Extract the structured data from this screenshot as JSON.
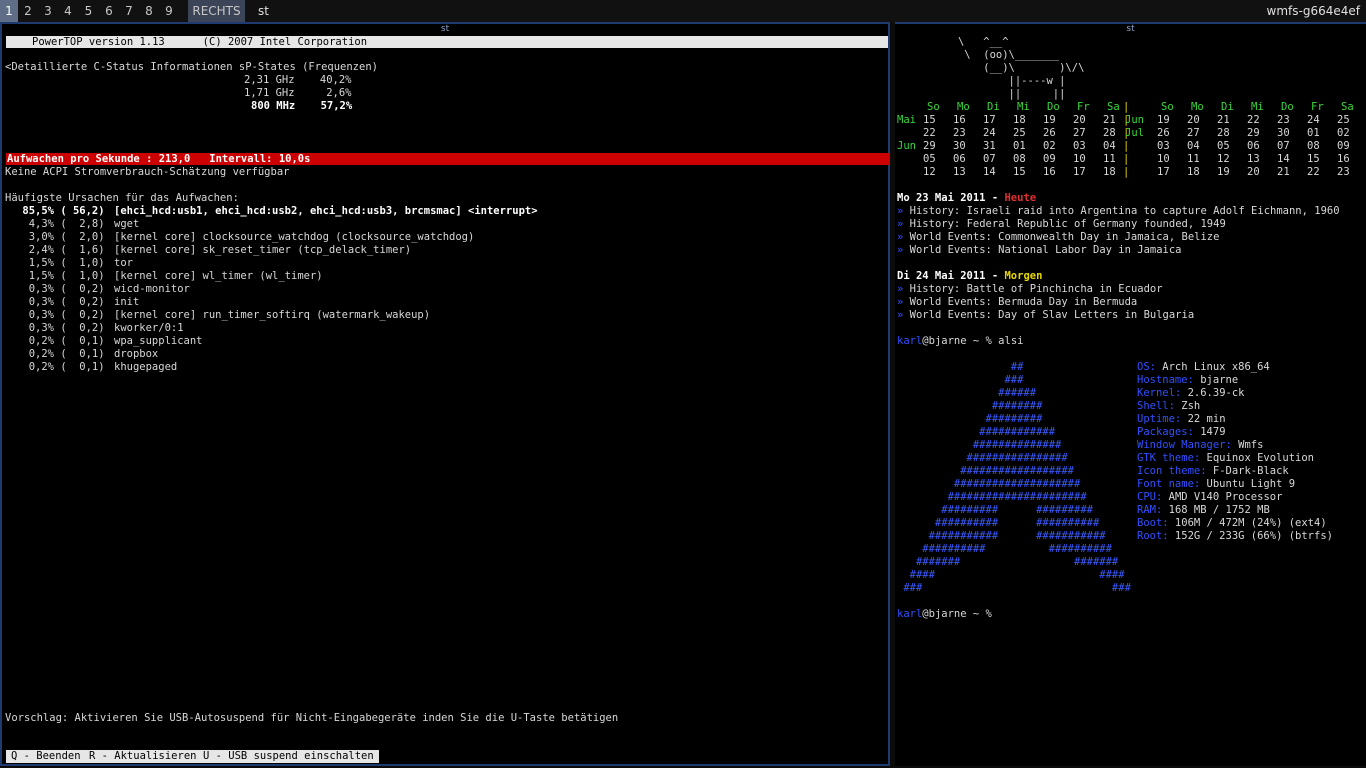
{
  "topbar": {
    "tags": [
      {
        "label": "1",
        "active": true
      },
      {
        "label": "2"
      },
      {
        "label": "3"
      },
      {
        "label": "4"
      },
      {
        "label": "5"
      },
      {
        "label": "6"
      },
      {
        "label": "7"
      },
      {
        "label": "8"
      },
      {
        "label": "9"
      }
    ],
    "layout": "RECHTS",
    "client_title": "st",
    "hostname": "wmfs-g664e4ef"
  },
  "left_window": {
    "title": "st",
    "powertop": {
      "header": "PowerTOP version 1.13      (C) 2007 Intel Corporation",
      "cstate_line": "<Detaillierte C-Status Informationen sP-States (Frequenzen)",
      "pstates": [
        {
          "freq": "2,31 GHz",
          "pct": "40,2%",
          "bold": false
        },
        {
          "freq": "1,71 GHz",
          "pct": "2,6%",
          "bold": false
        },
        {
          "freq": "800 MHz",
          "pct": "57,2%",
          "bold": true
        }
      ],
      "wakeups_bar": "Aufwachen pro Sekunde : 213,0   Intervall: 10,0s",
      "acpi_line": "Keine ACPI Stromverbrauch-Schätzung verfügbar",
      "causes_heading": "Häufigste Ursachen für das Aufwachen:",
      "causes": [
        {
          "pct": "85,5%",
          "count": "56,2",
          "name": "[ehci_hcd:usb1, ehci_hcd:usb2, ehci_hcd:usb3, brcmsmac] <interrupt>",
          "bold": true
        },
        {
          "pct": "4,3%",
          "count": "2,8",
          "name": "wget"
        },
        {
          "pct": "3,0%",
          "count": "2,0",
          "name": "[kernel core] clocksource_watchdog (clocksource_watchdog)"
        },
        {
          "pct": "2,4%",
          "count": "1,6",
          "name": "[kernel core] sk_reset_timer (tcp_delack_timer)"
        },
        {
          "pct": "1,5%",
          "count": "1,0",
          "name": "tor"
        },
        {
          "pct": "1,5%",
          "count": "1,0",
          "name": "[kernel core] wl_timer (wl_timer)"
        },
        {
          "pct": "0,3%",
          "count": "0,2",
          "name": "wicd-monitor"
        },
        {
          "pct": "0,3%",
          "count": "0,2",
          "name": "init"
        },
        {
          "pct": "0,3%",
          "count": "0,2",
          "name": "[kernel core] run_timer_softirq (watermark_wakeup)"
        },
        {
          "pct": "0,3%",
          "count": "0,2",
          "name": "kworker/0:1"
        },
        {
          "pct": "0,2%",
          "count": "0,1",
          "name": "wpa_supplicant"
        },
        {
          "pct": "0,2%",
          "count": "0,1",
          "name": "dropbox"
        },
        {
          "pct": "0,2%",
          "count": "0,1",
          "name": "khugepaged"
        }
      ],
      "suggestion": "Vorschlag: Aktivieren Sie USB-Autosuspend für Nicht-Eingabegeräte inden Sie die U-Taste betätigen",
      "function_keys": [
        "Q - Beenden",
        "R - Aktualisieren",
        "U - USB suspend einschalten"
      ]
    }
  },
  "right_window": {
    "title": "st",
    "cow": [
      "   \\   ^__^",
      "    \\  (oo)\\_______",
      "       (__)\\       )\\/\\",
      "           ||----w |",
      "           ||     ||"
    ],
    "calendar": {
      "weekdays": [
        "So",
        "Mo",
        "Di",
        "Mi",
        "Do",
        "Fr",
        "Sa"
      ],
      "months": [
        {
          "label": "Mai",
          "rows": [
            [
              "15",
              "16",
              "17",
              "18",
              "19",
              "20",
              "21"
            ],
            [
              "22",
              "23",
              "24",
              "25",
              "26",
              "27",
              "28"
            ]
          ]
        },
        {
          "label": "Jun",
          "rows": [
            [
              "29",
              "30",
              "31",
              "01",
              "02",
              "03",
              "04"
            ],
            [
              "05",
              "06",
              "07",
              "08",
              "09",
              "10",
              "11"
            ],
            [
              "12",
              "13",
              "14",
              "15",
              "16",
              "17",
              "18"
            ]
          ]
        }
      ],
      "months_right": [
        {
          "label": "Jun",
          "rows": [
            [
              "19",
              "20",
              "21",
              "22",
              "23",
              "24",
              "25"
            ]
          ]
        },
        {
          "label": "Jul",
          "rows": [
            [
              "26",
              "27",
              "28",
              "29",
              "30",
              "01",
              "02"
            ],
            [
              "03",
              "04",
              "05",
              "06",
              "07",
              "08",
              "09"
            ],
            [
              "10",
              "11",
              "12",
              "13",
              "14",
              "15",
              "16"
            ],
            [
              "17",
              "18",
              "19",
              "20",
              "21",
              "22",
              "23"
            ]
          ]
        }
      ]
    },
    "today": {
      "date": "Mo 23 Mai 2011",
      "sep": " - ",
      "label": "Heute",
      "events": [
        {
          "cat": "History",
          "text": "Israeli raid into Argentina to capture Adolf Eichmann, 1960"
        },
        {
          "cat": "History",
          "text": "Federal Republic of Germany founded, 1949"
        },
        {
          "cat": "World Events",
          "text": "Commonwealth Day in Jamaica, Belize"
        },
        {
          "cat": "World Events",
          "text": "National Labor Day in Jamaica"
        }
      ]
    },
    "tomorrow": {
      "date": "Di 24 Mai 2011",
      "sep": " - ",
      "label": "Morgen",
      "events": [
        {
          "cat": "History",
          "text": "Battle of Pinchincha in Ecuador"
        },
        {
          "cat": "World Events",
          "text": "Bermuda Day in Bermuda"
        },
        {
          "cat": "World Events",
          "text": "Day of Slav Letters in Bulgaria"
        }
      ]
    },
    "prompt_user": "karl",
    "prompt_host": "@bjarne ~ %",
    "command": "alsi",
    "alsi": [
      {
        "key": "OS",
        "value": "Arch Linux x86_64"
      },
      {
        "key": "Hostname",
        "value": "bjarne"
      },
      {
        "key": "Kernel",
        "value": "2.6.39-ck"
      },
      {
        "key": "Shell",
        "value": "Zsh"
      },
      {
        "key": "Uptime",
        "value": "22 min"
      },
      {
        "key": "Packages",
        "value": "1479"
      },
      {
        "key": "Window Manager",
        "value": "Wmfs"
      },
      {
        "key": "GTK theme",
        "value": "Equinox Evolution"
      },
      {
        "key": "Icon theme",
        "value": "F-Dark-Black"
      },
      {
        "key": "Font name",
        "value": "Ubuntu Light 9"
      },
      {
        "key": "CPU",
        "value": "AMD V140 Processor"
      },
      {
        "key": "RAM",
        "value": "168 MB / 1752 MB"
      },
      {
        "key": "Boot",
        "value": "106M / 472M (24%) (ext4)"
      },
      {
        "key": "Root",
        "value": "152G / 233G (66%) (btrfs)"
      }
    ],
    "arch_logo": [
      "                  ##",
      "                 ###",
      "                ######",
      "               ########",
      "              #########",
      "             ############",
      "            ##############",
      "           ################",
      "          ##################",
      "         ####################",
      "        ######################",
      "       #########      #########",
      "      ##########      ##########",
      "     ###########      ###########",
      "    ##########          ##########",
      "   #######                  #######",
      "  ####                          ####",
      " ###                              ###"
    ],
    "colors": {
      "accent": "#3050ff",
      "green": "#38d838",
      "yellow": "#e8d800",
      "red": "#e03030",
      "magenta": "#d030d0"
    }
  }
}
